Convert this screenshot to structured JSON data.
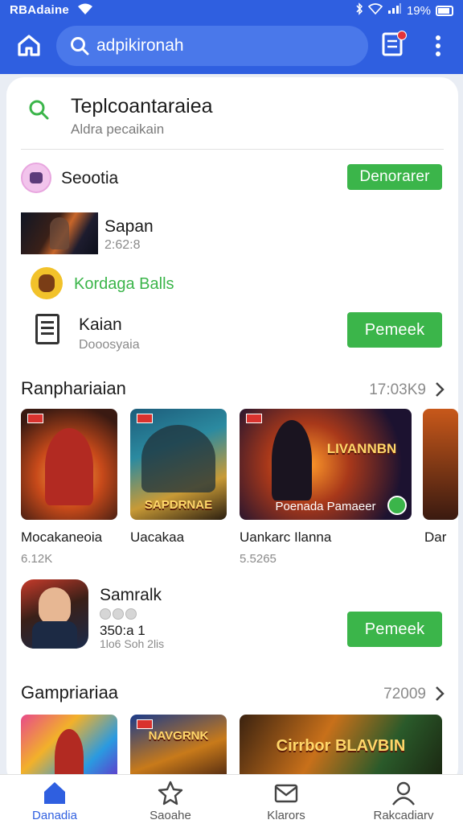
{
  "status_bar": {
    "carrier": "RBAdaine",
    "battery": "19%"
  },
  "search": {
    "text": "adpikironah"
  },
  "suggestions": {
    "title": "Teplcoantaraiea",
    "subtitle": "Aldra pecaikain",
    "rows": [
      {
        "title": "Seootia",
        "button": "Denorarer"
      },
      {
        "title": "Sapan",
        "sub": "2:62:8"
      },
      {
        "title": "Kordaga Balls"
      },
      {
        "title": "Kaian",
        "sub": "Dooosyaia",
        "button": "Pemeek"
      }
    ]
  },
  "section1": {
    "title": "Ranphariaian",
    "meta": "17:03K9",
    "tiles": [
      {
        "label": "Mocakaneoia",
        "sub": "6.12K",
        "art_text": ""
      },
      {
        "label": "Uacakaa",
        "sub": "",
        "art_text": "SAPDRNAE"
      },
      {
        "label": "Uankarc Ilanna",
        "sub": "5.5265",
        "art_text": "LIVANNBN",
        "inner_text": "Poenada Pamaeer"
      },
      {
        "label": "Dar",
        "sub": ""
      }
    ]
  },
  "featured": {
    "title": "Samralk",
    "meta": "350:a 1",
    "meta2": "1lo6 Soh 2lis",
    "button": "Pemeek"
  },
  "section2": {
    "title": "Gampriariaa",
    "meta": "72009",
    "tiles": [
      {
        "art_text": ""
      },
      {
        "art_text": "NAVGRNK"
      },
      {
        "art_text": "Cirrbor BLAVBIN"
      }
    ]
  },
  "bottom_nav": [
    {
      "label": "Danadia",
      "icon": "home-icon",
      "active": true
    },
    {
      "label": "Saoahe",
      "icon": "star-icon",
      "active": false
    },
    {
      "label": "Klarors",
      "icon": "mail-icon",
      "active": false
    },
    {
      "label": "Rakcadiarv",
      "icon": "person-icon",
      "active": false
    }
  ],
  "colors": {
    "primary": "#2f5fe0",
    "green": "#3bb54a"
  }
}
